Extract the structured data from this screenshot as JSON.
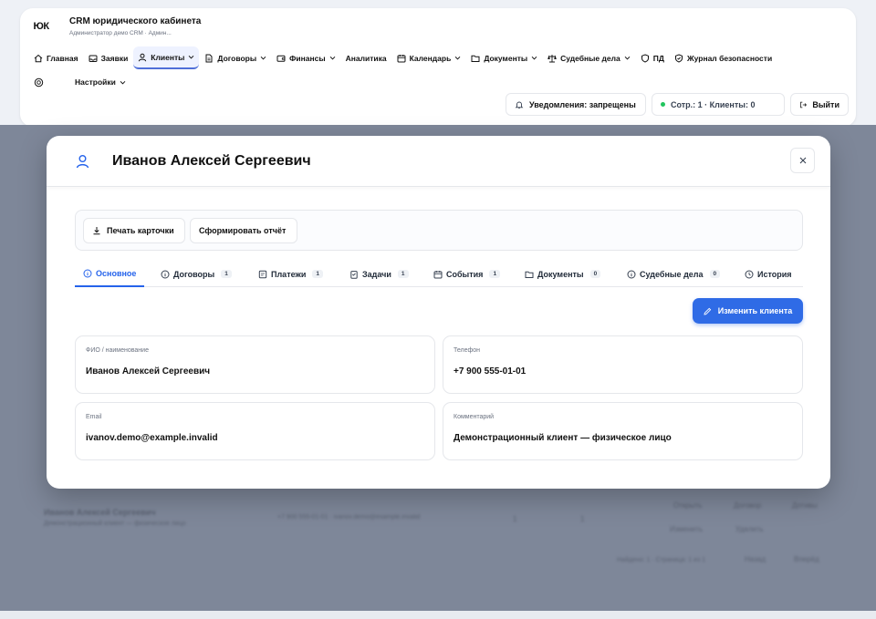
{
  "app": {
    "logo": "ЮК",
    "title": "CRM юридического кабинета",
    "subtitle": "Администратор демо CRM · Админ..."
  },
  "nav": [
    {
      "label": "Главная",
      "icon": "home-icon"
    },
    {
      "label": "Заявки",
      "icon": "inbox-icon"
    },
    {
      "label": "Клиенты",
      "icon": "user-icon",
      "active": true
    },
    {
      "label": "Договоры",
      "icon": "file-icon"
    },
    {
      "label": "Финансы",
      "icon": "wallet-icon"
    },
    {
      "label": "Аналитика"
    },
    {
      "label": "Календарь",
      "icon": "calendar-icon"
    },
    {
      "label": "Документы",
      "icon": "folder-icon"
    },
    {
      "label": "Судебные дела",
      "icon": "scale-icon"
    },
    {
      "label": "ПД",
      "icon": "shield-icon"
    },
    {
      "label": "Журнал безопасности",
      "icon": "shield-check-icon"
    }
  ],
  "nav2": {
    "settings_label": "Настройки"
  },
  "header_right": {
    "notifications": "Уведомления: запрещены",
    "status": "Сотр.: 1 · Клиенты: 0",
    "logout": "Выйти"
  },
  "modal": {
    "title": "Иванов Алексей Сергеевич",
    "print_label": "Печать карточки",
    "report_label": "Сформировать отчёт",
    "edit_label": "Изменить клиента",
    "tabs": [
      {
        "label": "Основное",
        "count": ""
      },
      {
        "label": "Договоры",
        "count": "1"
      },
      {
        "label": "Платежи",
        "count": "1"
      },
      {
        "label": "Задачи",
        "count": "1"
      },
      {
        "label": "События",
        "count": "1"
      },
      {
        "label": "Документы",
        "count": "0"
      },
      {
        "label": "Судебные дела",
        "count": "0"
      },
      {
        "label": "История",
        "count": ""
      }
    ],
    "fields": {
      "name_label": "ФИО / наименование",
      "name_value": "Иванов Алексей Сергеевич",
      "phone_label": "Телефон",
      "phone_value": "+7 900 555-01-01",
      "email_label": "Email",
      "email_value": "ivanov.demo@example.invalid",
      "comment_label": "Комментарий",
      "comment_value": "Демонстрационный клиент — физическое лицо"
    }
  },
  "background_row": {
    "name": "Иванов Алексей Сергеевич",
    "desc": "Демонстрационный клиент — физическое лицо",
    "contact": "+7 900 555-01-01 · ivanov.demo@example.invalid",
    "col1": "1",
    "col2": "1",
    "actions": [
      "Открыть",
      "Договор",
      "Дотивы",
      "Изменить",
      "Удалить"
    ],
    "pager": "Найдено: 1 · Страница: 1 из 1",
    "prev": "Назад",
    "next": "Вперёд"
  },
  "colors": {
    "accent": "#2f6be6",
    "backdrop": "#7e8799",
    "success": "#22c55e"
  }
}
